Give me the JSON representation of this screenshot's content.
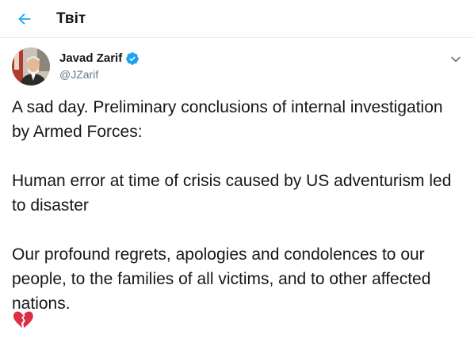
{
  "header": {
    "title": "Твіт",
    "back_icon": "arrow-left-icon"
  },
  "colors": {
    "accent": "#1da1f2",
    "text_primary": "#14171a",
    "text_secondary": "#657786",
    "divider": "#e6ecf0",
    "heart": "#dd2e44"
  },
  "tweet": {
    "author_name": "Javad Zarif",
    "author_handle": "@JZarif",
    "verified_icon": "verified-badge-icon",
    "menu_icon": "chevron-down-icon",
    "paragraphs": [
      "A sad day. Preliminary conclusions of internal investigation by Armed Forces:",
      "Human error at time of crisis caused by US adventurism led to disaster",
      "Our profound regrets, apologies and condolences to our people, to the families of all victims, and to other affected nations."
    ],
    "emoji": "broken-heart-icon"
  }
}
